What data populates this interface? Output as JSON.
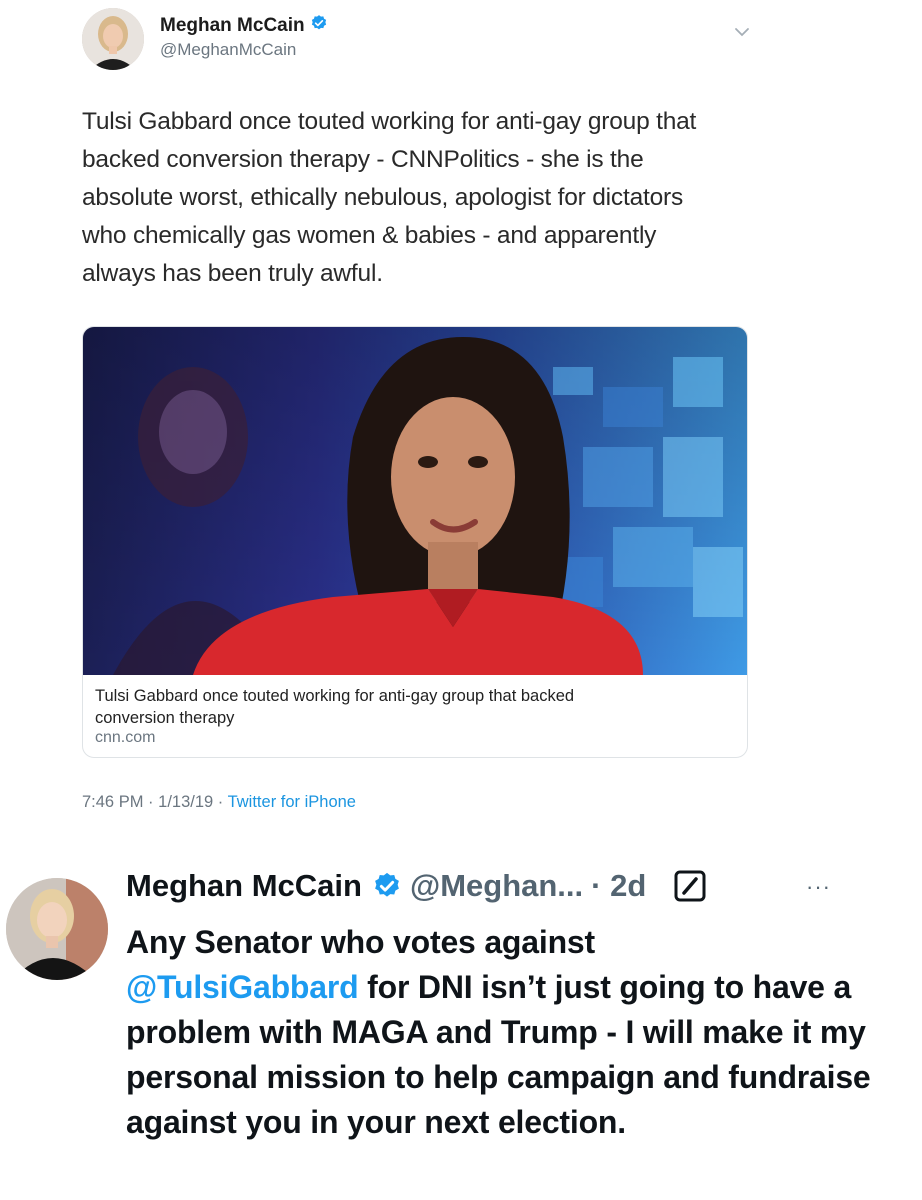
{
  "tweet1": {
    "author_name": "Meghan McCain",
    "author_handle": "@MeghanMcCain",
    "text": "Tulsi Gabbard once touted working for anti-gay group that backed conversion therapy - CNNPolitics - she is the absolute worst, ethically nebulous, apologist for dictators who chemically gas women & babies -  and apparently always has been truly awful.",
    "text_lines": [
      "Tulsi Gabbard once touted working for anti-gay group that",
      "backed conversion therapy - CNNPolitics - she is the",
      "absolute worst, ethically nebulous, apologist for dictators",
      "who chemically gas women & babies -  and apparently",
      "always has been truly awful."
    ],
    "link_card": {
      "title_line1": "Tulsi Gabbard once touted working for anti-gay group that backed",
      "title_line2": "conversion therapy",
      "domain": "cnn.com"
    },
    "time": "7:46 PM",
    "date": "1/13/19",
    "source": "Twitter for iPhone",
    "separator": "·"
  },
  "tweet2": {
    "author_name": "Meghan McCain",
    "author_handle": "@Meghan...",
    "time_sep": "·",
    "time": "2d",
    "more": "···",
    "text_part1": "Any Senator who votes against",
    "mention": "@TulsiGabbard",
    "text_part2": " for DNI isn’t just going to have a problem with MAGA and Trump - I will make it my personal mission to help campaign and fundraise against you in your next election."
  },
  "colors": {
    "verified": "#1d9bf0",
    "link": "#1d9bf0",
    "source_link": "#1b95e0",
    "muted": "#6b7680"
  }
}
